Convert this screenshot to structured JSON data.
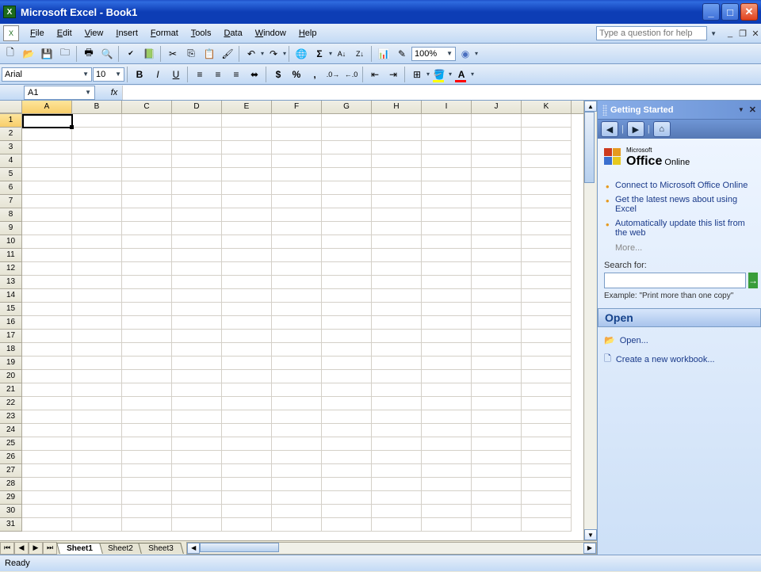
{
  "title": "Microsoft Excel - Book1",
  "menus": [
    "File",
    "Edit",
    "View",
    "Insert",
    "Format",
    "Tools",
    "Data",
    "Window",
    "Help"
  ],
  "help_placeholder": "Type a question for help",
  "zoom": "100%",
  "font_name": "Arial",
  "font_size": "10",
  "name_box": "A1",
  "columns": [
    "A",
    "B",
    "C",
    "D",
    "E",
    "F",
    "G",
    "H",
    "I",
    "J",
    "K"
  ],
  "active_col": "A",
  "rowcount": 31,
  "active_row": 1,
  "sheets": [
    "Sheet1",
    "Sheet2",
    "Sheet3"
  ],
  "active_sheet": "Sheet1",
  "taskpane": {
    "title": "Getting Started",
    "office_small": "Microsoft",
    "office_big": "Office",
    "office_suffix": "Online",
    "links": [
      "Connect to Microsoft Office Online",
      "Get the latest news about using Excel",
      "Automatically update this list from the web"
    ],
    "more": "More...",
    "search_label": "Search for:",
    "example": "Example:  \"Print more than one copy\"",
    "open_header": "Open",
    "open_link": "Open...",
    "create_link": "Create a new workbook..."
  },
  "status": "Ready"
}
